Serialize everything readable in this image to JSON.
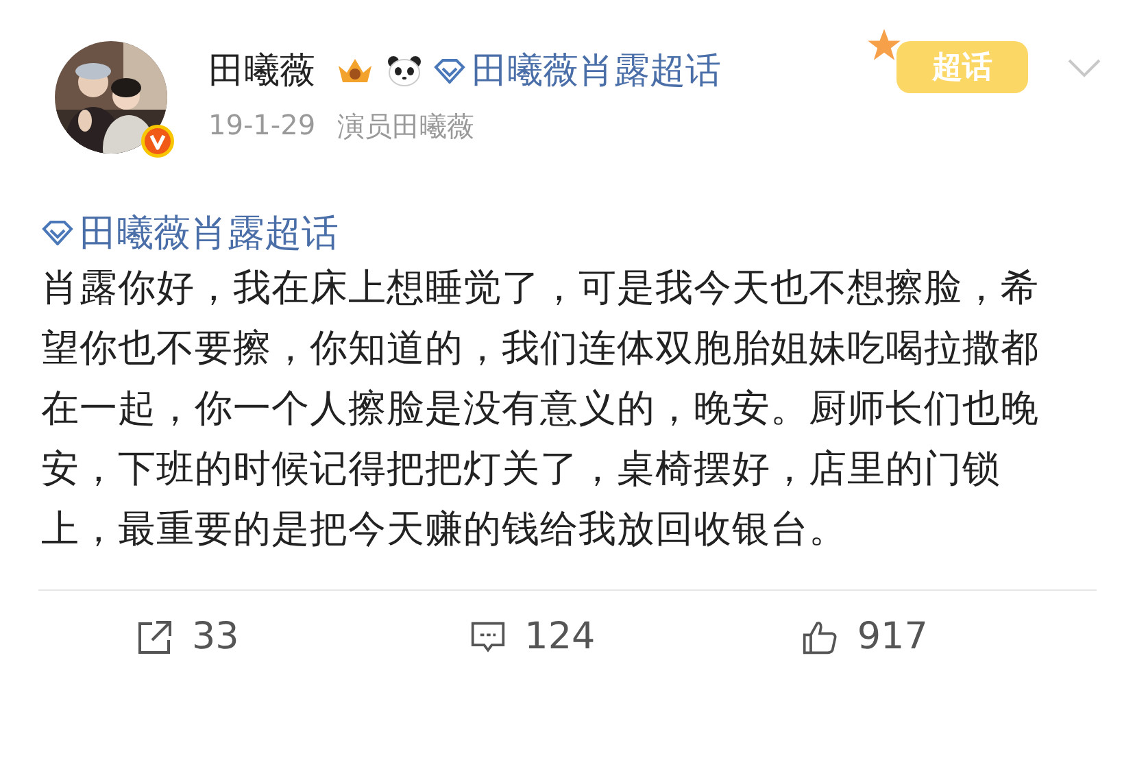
{
  "author": {
    "name": "田曦薇",
    "verified": true,
    "date": "19-1-29",
    "source": "演员田曦薇",
    "topic_link": "田曦薇肖露超话"
  },
  "sticker": "超话",
  "topic": "田曦薇肖露超话",
  "text": "肖露你好，我在床上想睡觉了，可是我今天也不想擦脸，希望你也不要擦，你知道的，我们连体双胞胎姐妹吃喝拉撒都在一起，你一个人擦脸是没有意义的，晚安。厨师长们也晚安，下班的时候记得把把灯关了，桌椅摆好，店里的门锁上，最重要的是把今天赚的钱给我放回收银台。",
  "actions": [
    {
      "kind": "repost",
      "count": "33"
    },
    {
      "kind": "comment",
      "count": "124"
    },
    {
      "kind": "like",
      "count": "917"
    }
  ]
}
